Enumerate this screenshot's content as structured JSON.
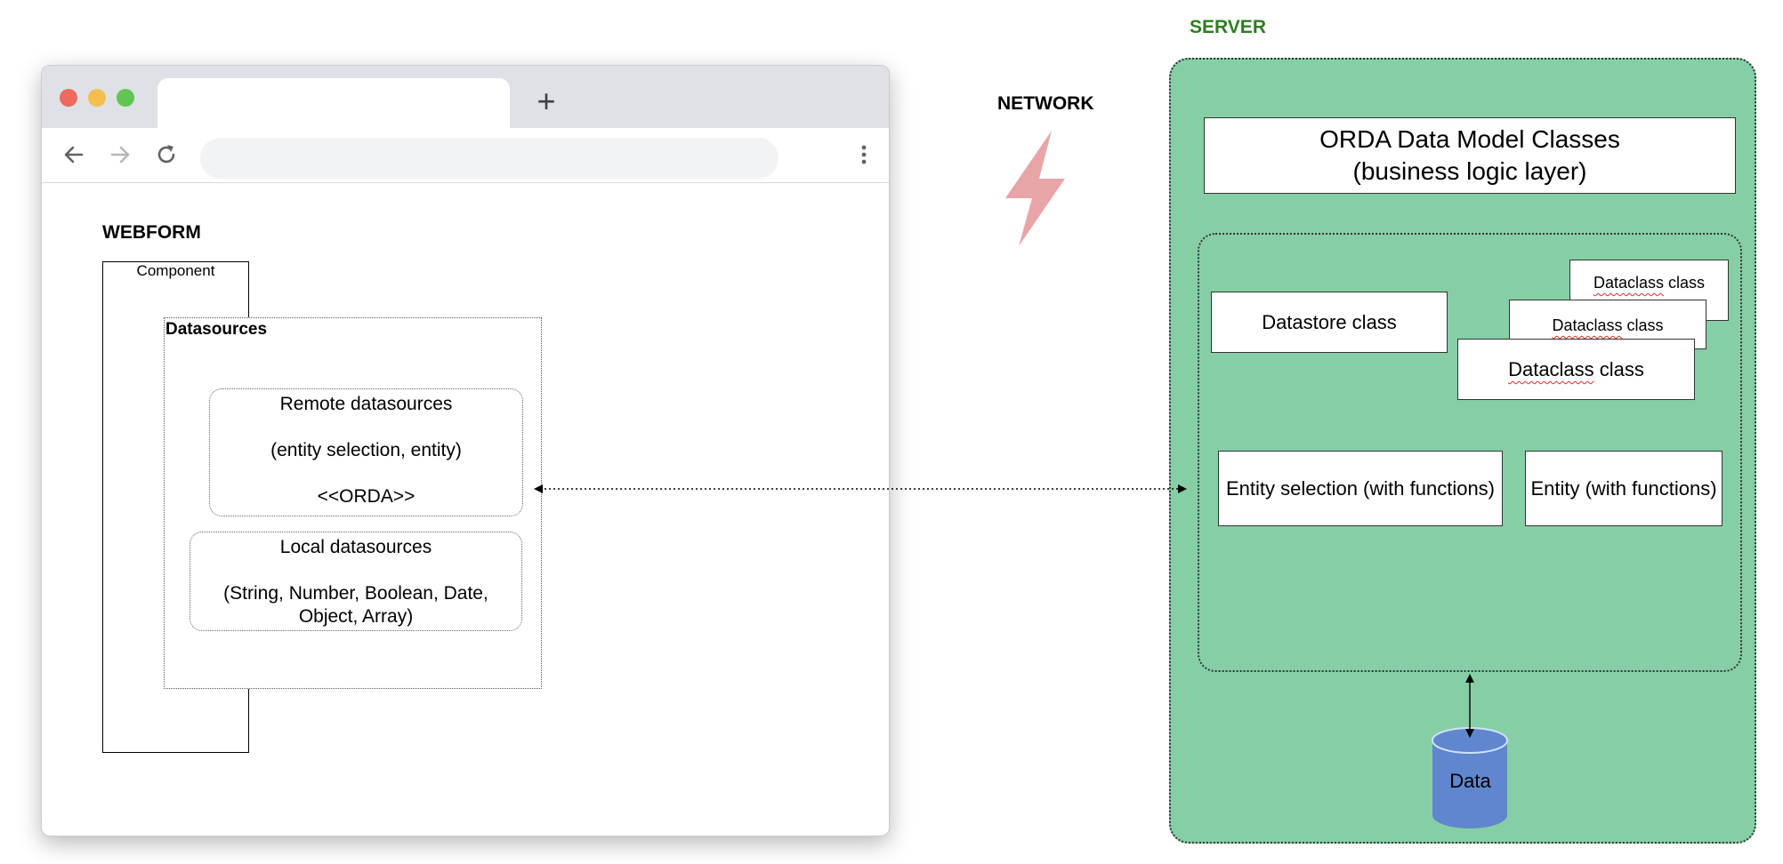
{
  "browser": {
    "new_tab_label": "+",
    "traffic_light_colors": [
      "#ec6a5e",
      "#f4bf4f",
      "#61c554"
    ],
    "icons": [
      "back-arrow-icon",
      "forward-arrow-icon",
      "reload-icon",
      "kebab-menu-icon"
    ]
  },
  "webform": {
    "title": "WEBFORM",
    "component_label": "Component",
    "datasources_label": "Datasources",
    "remote": {
      "title": "Remote datasources",
      "subtitle": "(entity selection, entity)",
      "tag": "<<ORDA>>"
    },
    "local": {
      "title": "Local datasources",
      "line1": "(String, Number, Boolean, Date,",
      "line2": "Object, Array)"
    }
  },
  "network": {
    "label": "NETWORK",
    "bolt_color": "#e8a5a8"
  },
  "server": {
    "label": "SERVER",
    "label_color": "#2f7d21",
    "box_color": "#86cfa6",
    "orda_line1": "ORDA Data Model Classes",
    "orda_line2": "(business logic layer)",
    "datastore_class": "Datastore class",
    "dataclass_prefix": "Dataclass",
    "dataclass_suffix": " class",
    "entity_selection": "Entity selection (with functions)",
    "entity": "Entity (with functions)",
    "data_label": "Data",
    "db_color": "#5f86cf"
  }
}
